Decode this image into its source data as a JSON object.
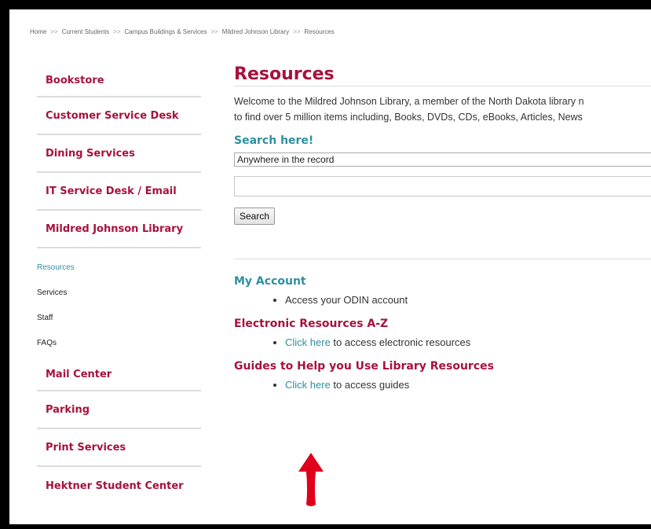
{
  "breadcrumb": {
    "separator": ">>",
    "items": [
      "Home",
      "Current Students",
      "Campus Buildings & Services",
      "Mildred Johnson Library",
      "Resources"
    ]
  },
  "sidebar": {
    "items_top": [
      "Bookstore",
      "Customer Service Desk",
      "Dining Services",
      "IT Service Desk / Email",
      "Mildred Johnson Library"
    ],
    "sub_items": [
      "Resources",
      "Services",
      "Staff",
      "FAQs"
    ],
    "items_bottom": [
      "Mail Center",
      "Parking",
      "Print Services",
      "Hektner Student Center"
    ]
  },
  "main": {
    "title": "Resources",
    "intro_line1": "Welcome to the Mildred Johnson Library, a member of the North Dakota library n",
    "intro_line2": "to find over 5 million items including, Books, DVDs, CDs, eBooks, Articles, News",
    "search_heading": "Search here!",
    "search_scope_value": "Anywhere in the record",
    "search_input_value": "",
    "search_button": "Search",
    "account_heading": "My Account",
    "account_item": "Access your ODIN account",
    "eresources_heading": "Electronic Resources A-Z",
    "eresources_link": "Click here",
    "eresources_rest": " to access electronic resources",
    "guides_heading": "Guides to Help you Use Library Resources",
    "guides_link": "Click here",
    "guides_rest": " to access guides"
  },
  "colors": {
    "accent_red": "#a6123d",
    "accent_teal": "#2f8fa0",
    "annotation_arrow": "#e0001b"
  }
}
